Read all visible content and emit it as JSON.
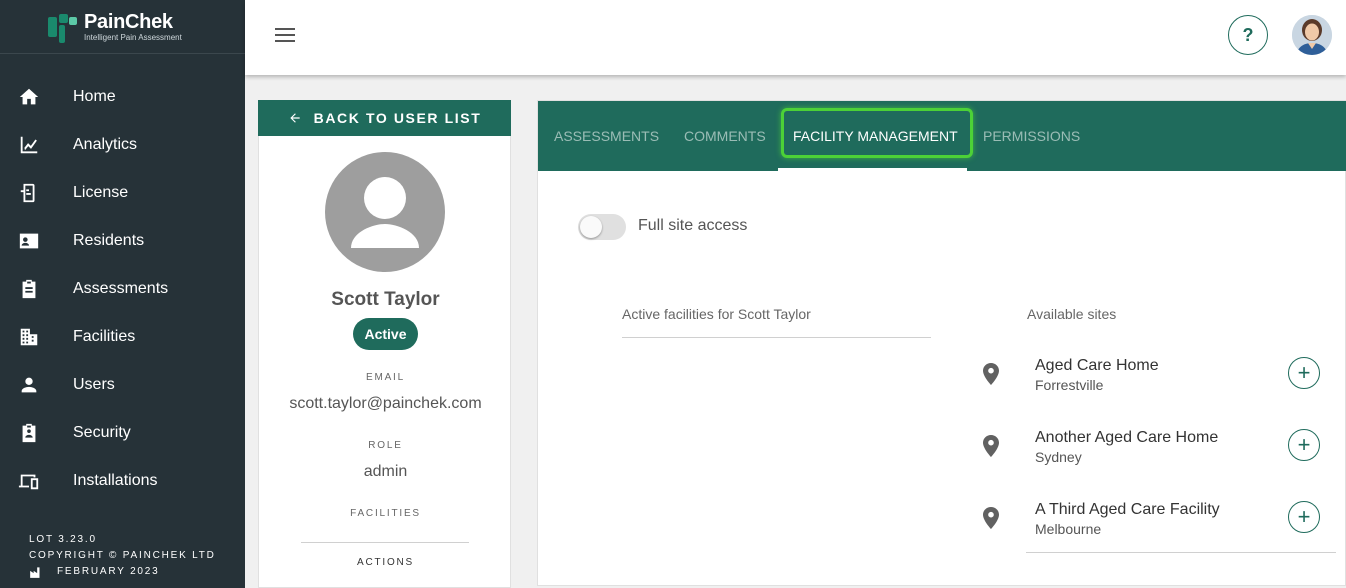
{
  "brand": {
    "name": "PainChek",
    "tagline": "Intelligent Pain Assessment"
  },
  "sidebar": {
    "items": [
      {
        "label": "Home",
        "icon": "home-icon"
      },
      {
        "label": "Analytics",
        "icon": "analytics-icon"
      },
      {
        "label": "License",
        "icon": "license-icon"
      },
      {
        "label": "Residents",
        "icon": "residents-icon"
      },
      {
        "label": "Assessments",
        "icon": "assessments-icon"
      },
      {
        "label": "Facilities",
        "icon": "facilities-icon"
      },
      {
        "label": "Users",
        "icon": "users-icon"
      },
      {
        "label": "Security",
        "icon": "security-icon"
      },
      {
        "label": "Installations",
        "icon": "installations-icon"
      }
    ],
    "footer": {
      "version": "LOT 3.23.0",
      "copyright": "COPYRIGHT © PAINCHEK LTD",
      "date": "FEBRUARY 2023"
    }
  },
  "topbar": {
    "help_label": "?"
  },
  "user": {
    "back_label": "BACK TO USER LIST",
    "name": "Scott Taylor",
    "status": "Active",
    "email_label": "EMAIL",
    "email": "scott.taylor@painchek.com",
    "role_label": "ROLE",
    "role": "admin",
    "facilities_label": "FACILITIES",
    "actions_label": "ACTIONS"
  },
  "tabs": [
    {
      "label": "ASSESSMENTS",
      "active": false
    },
    {
      "label": "COMMENTS",
      "active": false
    },
    {
      "label": "FACILITY MANAGEMENT",
      "active": true
    },
    {
      "label": "PERMISSIONS",
      "active": false
    }
  ],
  "facility_management": {
    "full_site_access_label": "Full site access",
    "full_site_access": false,
    "active_heading": "Active facilities for Scott Taylor",
    "available_heading": "Available sites",
    "sites": [
      {
        "name": "Aged Care Home",
        "location": "Forrestville"
      },
      {
        "name": "Another Aged Care Home",
        "location": "Sydney"
      },
      {
        "name": "A Third Aged Care Facility",
        "location": "Melbourne"
      }
    ]
  },
  "colors": {
    "primary": "#1f6b5c",
    "sidebar": "#263238",
    "highlight": "#4cd137"
  }
}
